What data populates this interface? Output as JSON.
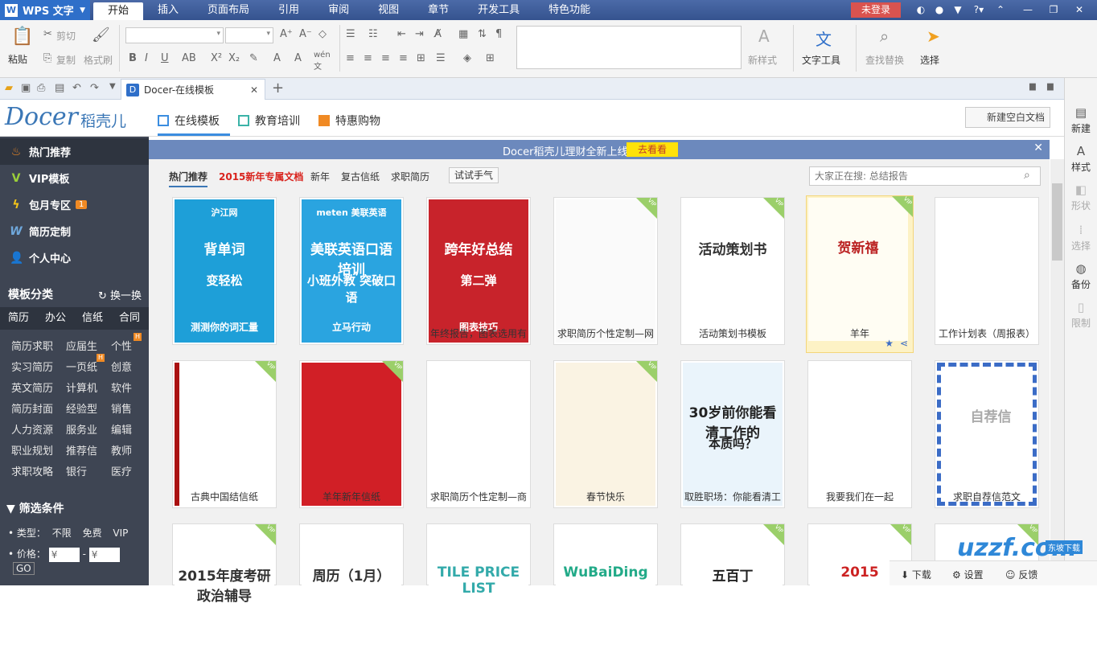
{
  "titlebar": {
    "app_name": "WPS 文字",
    "menu": [
      "开始",
      "插入",
      "页面布局",
      "引用",
      "审阅",
      "视图",
      "章节",
      "开发工具",
      "特色功能"
    ],
    "login": "未登录"
  },
  "ribbon": {
    "paste": "粘贴",
    "cut": "剪切",
    "copy": "复制",
    "format_painter": "格式刷",
    "new_style": "新样式",
    "text_tools": "文字工具",
    "find_replace": "查找替换",
    "select": "选择"
  },
  "doc_tab": {
    "title": "Docer-在线模板",
    "add": "+"
  },
  "docer": {
    "logo": "Docer",
    "logo_cn": "稻壳儿",
    "tabs": [
      "在线模板",
      "教育培训",
      "特惠购物"
    ],
    "new_blank": "新建空白文档"
  },
  "sidebar": {
    "items": [
      {
        "label": "热门推荐",
        "icon": "fire-icon"
      },
      {
        "label": "VIP模板",
        "icon": "vip-icon"
      },
      {
        "label": "包月专区",
        "icon": "lightning-icon",
        "badge": "1"
      },
      {
        "label": "简历定制",
        "icon": "w-icon"
      },
      {
        "label": "个人中心",
        "icon": "user-icon"
      }
    ],
    "category_title": "模板分类",
    "swap": "换一换",
    "category_tabs": [
      "简历",
      "办公",
      "信纸",
      "合同"
    ],
    "sub_items": [
      [
        "简历求职",
        "应届生",
        "个性"
      ],
      [
        "实习简历",
        "一页纸",
        "创意"
      ],
      [
        "英文简历",
        "计算机",
        "软件"
      ],
      [
        "简历封面",
        "经验型",
        "销售"
      ],
      [
        "人力资源",
        "服务业",
        "编辑"
      ],
      [
        "职业规划",
        "推荐信",
        "教师"
      ],
      [
        "求职攻略",
        "银行",
        "医疗"
      ]
    ],
    "hot_badge": "H",
    "filter_title": "筛选条件",
    "type_label": "• 类型：",
    "type_options": [
      "不限",
      "免费",
      "VIP"
    ],
    "price_label": "• 价格：",
    "price_from": "¥",
    "price_dash": "-",
    "price_to": "¥",
    "go": "GO"
  },
  "banner": {
    "text": "Docer稻壳儿理财全新上线",
    "button": "去看看",
    "close": "✕"
  },
  "hot_tabs": [
    "热门推荐",
    "2015新年专属文档",
    "新年",
    "复古信纸",
    "求职简历"
  ],
  "try_button": "试试手气",
  "search": {
    "placeholder": "大家正在搜: 总结报告"
  },
  "cards_row1": [
    {
      "caption": "",
      "thumb_title": "背单词",
      "thumb_sub": "变轻松",
      "thumb_foot": "测测你的词汇量",
      "brand": "沪江网"
    },
    {
      "caption": "",
      "thumb_title": "美联英语口语培训",
      "thumb_sub": "小班外教 突破口语",
      "thumb_foot": "立马行动",
      "brand": "meten 美联英语"
    },
    {
      "caption": "年终报告，图表选用有",
      "thumb_title": "跨年好总结",
      "thumb_sub": "第二弹",
      "thumb_foot": "图表技巧"
    },
    {
      "caption": "求职简历个性定制—网"
    },
    {
      "caption": "活动策划书模板",
      "thumb_title": "活动策划书"
    },
    {
      "caption": "羊年",
      "thumb_title": "贺新禧"
    },
    {
      "caption": "工作计划表（周报表）"
    }
  ],
  "cards_row2": [
    {
      "caption": "古典中国结信纸"
    },
    {
      "caption": "羊年新年信纸"
    },
    {
      "caption": "求职简历个性定制—商"
    },
    {
      "caption": "春节快乐"
    },
    {
      "caption": "取胜职场：你能看清工",
      "thumb_title": "30岁前你能看清工作的",
      "thumb_sub": "本质吗？"
    },
    {
      "caption": "我要我们在一起"
    },
    {
      "caption": "求职自荐信范文",
      "thumb_title": "自荐信"
    }
  ],
  "cards_row3": [
    {
      "thumb_title": "2015年度考研政治辅导"
    },
    {
      "thumb_title": "周历（1月）"
    },
    {
      "thumb_title": "TILE PRICE LIST"
    },
    {
      "thumb_title": "WuBaiDing"
    },
    {
      "thumb_title": "五百丁"
    },
    {
      "thumb_title": "2015"
    },
    {
      "thumb_title": ""
    }
  ],
  "vip_tag": "VIP",
  "right_panel": {
    "items": [
      {
        "label": "新建",
        "enabled": true
      },
      {
        "label": "样式",
        "enabled": true
      },
      {
        "label": "形状",
        "enabled": false
      },
      {
        "label": "选择",
        "enabled": false
      },
      {
        "label": "备份",
        "enabled": true
      },
      {
        "label": "限制",
        "enabled": false
      }
    ]
  },
  "bottom_bar": {
    "download": "下载",
    "settings": "设置",
    "feedback": "反馈"
  },
  "watermark": {
    "text": "uzzf.com",
    "sub": "东坡下载"
  },
  "colors": {
    "titlebar": "#3b5998",
    "sidebar": "#3e4553",
    "banner": "#6c89bd",
    "login": "#d9534f",
    "accent": "#3b8de0"
  }
}
